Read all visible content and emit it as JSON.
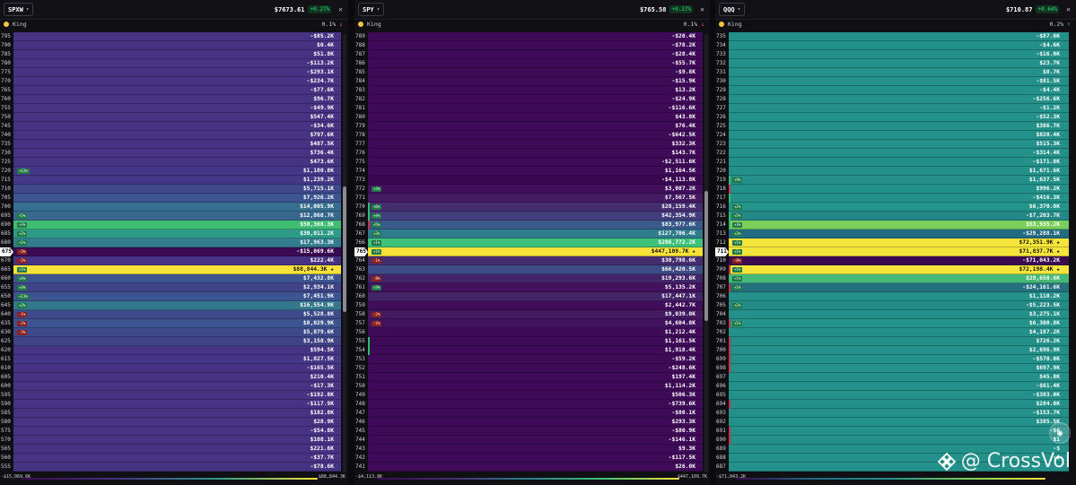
{
  "panels": [
    {
      "ticker": "SPXW",
      "price": "$7673.61",
      "change": "+0.27%",
      "king_label": "King",
      "king_pct": "0.1%",
      "king_dir": "dn",
      "footer_left": "-$15,069.6K",
      "footer_right": "$88,844.3K",
      "pin_strike": "675",
      "rows": [
        {
          "s": "795",
          "v": "-$85.2K",
          "c": "#463383"
        },
        {
          "s": "790",
          "v": "$0.4K",
          "c": "#463383"
        },
        {
          "s": "785",
          "v": "$51.8K",
          "c": "#463383"
        },
        {
          "s": "780",
          "v": "-$113.2K",
          "c": "#463383"
        },
        {
          "s": "775",
          "v": "-$293.1K",
          "c": "#463383"
        },
        {
          "s": "770",
          "v": "-$234.7K",
          "c": "#463383"
        },
        {
          "s": "765",
          "v": "-$77.6K",
          "c": "#463383"
        },
        {
          "s": "760",
          "v": "$96.7K",
          "c": "#463383"
        },
        {
          "s": "755",
          "v": "-$49.9K",
          "c": "#463383"
        },
        {
          "s": "750",
          "v": "$547.4K",
          "c": "#463383"
        },
        {
          "s": "745",
          "v": "-$34.6K",
          "c": "#463383"
        },
        {
          "s": "740",
          "v": "$797.6K",
          "c": "#463383"
        },
        {
          "s": "735",
          "v": "$487.5K",
          "c": "#463383"
        },
        {
          "s": "730",
          "v": "$736.4K",
          "c": "#463383"
        },
        {
          "s": "725",
          "v": "$473.6K",
          "c": "#463383"
        },
        {
          "s": "720",
          "v": "$1,180.8K",
          "c": "#453787",
          "t": "+12%",
          "tc": "tg"
        },
        {
          "s": "715",
          "v": "$1,239.2K",
          "c": "#453787"
        },
        {
          "s": "710",
          "v": "$5,715.1K",
          "c": "#3f4a8b"
        },
        {
          "s": "705",
          "v": "$7,926.2K",
          "c": "#3c5591"
        },
        {
          "s": "700",
          "v": "$14,005.9K",
          "c": "#366e8f"
        },
        {
          "s": "695",
          "v": "$12,868.7K",
          "c": "#38688f",
          "t": "+5%",
          "tc": "tg"
        },
        {
          "s": "690",
          "v": "$50,368.3K",
          "c": "#3fbd72",
          "t": "+3%",
          "tc": "tg"
        },
        {
          "s": "685",
          "v": "$30,011.2K",
          "c": "#2d9b88",
          "t": "+2%",
          "tc": "tg"
        },
        {
          "s": "680",
          "v": "$17,963.3K",
          "c": "#337c8e",
          "t": "+1%",
          "tc": "tg"
        },
        {
          "s": "675",
          "v": "-$15,069.6K",
          "c": "#3a0a52",
          "t": "-3%",
          "tc": "tr"
        },
        {
          "s": "670",
          "v": "$222.4K",
          "c": "#463383",
          "t": "-2%",
          "tc": "tr"
        },
        {
          "s": "665",
          "v": "$88,844.3K",
          "c": "#f7e23a",
          "t": "+1%",
          "tc": "tg",
          "dark": true
        },
        {
          "s": "660",
          "v": "$7,432.8K",
          "c": "#3c5591",
          "t": "+4%",
          "tc": "tg"
        },
        {
          "s": "655",
          "v": "$2,934.1K",
          "c": "#414387",
          "t": "+3%",
          "tc": "tg"
        },
        {
          "s": "650",
          "v": "$7,451.9K",
          "c": "#3c5591",
          "t": "+11%",
          "tc": "tg"
        },
        {
          "s": "645",
          "v": "$16,554.9K",
          "c": "#34788e",
          "t": "+2%",
          "tc": "tg"
        },
        {
          "s": "640",
          "v": "$5,528.8K",
          "c": "#3f4a8b",
          "t": "-1%",
          "tc": "tr"
        },
        {
          "s": "635",
          "v": "$8,029.9K",
          "c": "#3c5591",
          "t": "-2%",
          "tc": "tr"
        },
        {
          "s": "630",
          "v": "$5,879.6K",
          "c": "#3f4a8b",
          "t": "-3%",
          "tc": "tr"
        },
        {
          "s": "625",
          "v": "$3,158.9K",
          "c": "#414387"
        },
        {
          "s": "620",
          "v": "$594.5K",
          "c": "#463383"
        },
        {
          "s": "615",
          "v": "$1,827.5K",
          "c": "#453787"
        },
        {
          "s": "610",
          "v": "-$165.5K",
          "c": "#463383"
        },
        {
          "s": "605",
          "v": "$210.4K",
          "c": "#463383"
        },
        {
          "s": "600",
          "v": "-$17.3K",
          "c": "#463383"
        },
        {
          "s": "595",
          "v": "-$192.8K",
          "c": "#463383"
        },
        {
          "s": "590",
          "v": "-$117.9K",
          "c": "#463383"
        },
        {
          "s": "585",
          "v": "$182.8K",
          "c": "#463383"
        },
        {
          "s": "580",
          "v": "$28.9K",
          "c": "#463383"
        },
        {
          "s": "575",
          "v": "-$54.8K",
          "c": "#463383"
        },
        {
          "s": "570",
          "v": "$108.1K",
          "c": "#463383"
        },
        {
          "s": "565",
          "v": "$221.6K",
          "c": "#463383"
        },
        {
          "s": "560",
          "v": "-$37.7K",
          "c": "#463383"
        },
        {
          "s": "555",
          "v": "-$78.6K",
          "c": "#463383"
        }
      ]
    },
    {
      "ticker": "SPY",
      "price": "$765.58",
      "change": "+0.27%",
      "king_label": "King",
      "king_pct": "0.1%",
      "king_dir": "dn",
      "footer_left": "-$4,113.8K",
      "footer_right": "$447,109.7K",
      "pin_strike": "765",
      "rows": [
        {
          "s": "789",
          "v": "-$20.4K",
          "c": "#3f0a58"
        },
        {
          "s": "788",
          "v": "-$78.2K",
          "c": "#3f0a58"
        },
        {
          "s": "787",
          "v": "-$28.4K",
          "c": "#3f0a58"
        },
        {
          "s": "786",
          "v": "-$55.7K",
          "c": "#3f0a58"
        },
        {
          "s": "785",
          "v": "-$9.8K",
          "c": "#3f0a58"
        },
        {
          "s": "784",
          "v": "-$15.9K",
          "c": "#3f0a58"
        },
        {
          "s": "783",
          "v": "$13.2K",
          "c": "#3f0a58"
        },
        {
          "s": "782",
          "v": "-$24.9K",
          "c": "#3f0a58"
        },
        {
          "s": "781",
          "v": "-$116.6K",
          "c": "#3f0a58"
        },
        {
          "s": "780",
          "v": "$43.8K",
          "c": "#3f0a58"
        },
        {
          "s": "779",
          "v": "$76.4K",
          "c": "#3f0a58"
        },
        {
          "s": "778",
          "v": "-$642.5K",
          "c": "#3f0a58"
        },
        {
          "s": "777",
          "v": "$332.3K",
          "c": "#3f0a58"
        },
        {
          "s": "776",
          "v": "$143.7K",
          "c": "#3f0a58"
        },
        {
          "s": "775",
          "v": "-$2,511.6K",
          "c": "#3f0a58"
        },
        {
          "s": "774",
          "v": "$1,164.5K",
          "c": "#3f0a58"
        },
        {
          "s": "773",
          "v": "-$4,113.8K",
          "c": "#3a0752"
        },
        {
          "s": "772",
          "v": "$3,087.2K",
          "c": "#420f5c",
          "t": "+3%",
          "tc": "tg"
        },
        {
          "s": "771",
          "v": "$7,567.5K",
          "c": "#441a62"
        },
        {
          "s": "770",
          "v": "$28,159.4K",
          "c": "#452e70",
          "t": "+6%",
          "tc": "tg",
          "b": "#2fbf6a"
        },
        {
          "s": "769",
          "v": "$42,354.9K",
          "c": "#433e7e",
          "t": "+4%",
          "tc": "tg",
          "b": "#2fbf6a"
        },
        {
          "s": "768",
          "v": "$83,977.6K",
          "c": "#3a5a8b",
          "t": "+5%",
          "tc": "tg",
          "b": "#c9344a"
        },
        {
          "s": "767",
          "v": "$127,706.4K",
          "c": "#2f7c8d",
          "t": "+3%",
          "tc": "tg"
        },
        {
          "s": "766",
          "v": "$286,772.2K",
          "c": "#3ec27a",
          "t": "+1%",
          "tc": "tg"
        },
        {
          "s": "765",
          "v": "$447,109.7K",
          "c": "#f7e23a",
          "t": "+1%",
          "tc": "tg",
          "dark": true
        },
        {
          "s": "764",
          "v": "$30,798.6K",
          "c": "#452e70",
          "t": "-1%",
          "tc": "tr"
        },
        {
          "s": "763",
          "v": "$66,420.5K",
          "c": "#3d4b86"
        },
        {
          "s": "762",
          "v": "$19,293.6K",
          "c": "#45256a",
          "t": "-8%",
          "tc": "tr"
        },
        {
          "s": "761",
          "v": "$5,135.2K",
          "c": "#42125e",
          "t": "+3%",
          "tc": "tg"
        },
        {
          "s": "760",
          "v": "$17,447.1K",
          "c": "#45256a"
        },
        {
          "s": "759",
          "v": "$2,442.7K",
          "c": "#400d5a"
        },
        {
          "s": "758",
          "v": "$9,039.0K",
          "c": "#431a62",
          "t": "-2%",
          "tc": "tr"
        },
        {
          "s": "757",
          "v": "$4,604.8K",
          "c": "#42125e",
          "t": "-2%",
          "tc": "tr"
        },
        {
          "s": "756",
          "v": "$1,212.4K",
          "c": "#3f0a58"
        },
        {
          "s": "755",
          "v": "$1,161.5K",
          "c": "#3f0a58",
          "b": "#2fbf6a"
        },
        {
          "s": "754",
          "v": "$1,918.4K",
          "c": "#3f0a58",
          "b": "#2fbf6a"
        },
        {
          "s": "753",
          "v": "-$59.2K",
          "c": "#3f0a58"
        },
        {
          "s": "752",
          "v": "-$248.6K",
          "c": "#3f0a58"
        },
        {
          "s": "751",
          "v": "$197.4K",
          "c": "#3f0a58"
        },
        {
          "s": "750",
          "v": "$1,114.2K",
          "c": "#3f0a58"
        },
        {
          "s": "749",
          "v": "$506.3K",
          "c": "#3f0a58"
        },
        {
          "s": "748",
          "v": "-$739.6K",
          "c": "#3f0a58"
        },
        {
          "s": "747",
          "v": "-$80.1K",
          "c": "#3f0a58"
        },
        {
          "s": "746",
          "v": "$293.3K",
          "c": "#3f0a58"
        },
        {
          "s": "745",
          "v": "-$80.9K",
          "c": "#3f0a58"
        },
        {
          "s": "744",
          "v": "-$146.1K",
          "c": "#3f0a58"
        },
        {
          "s": "743",
          "v": "$9.3K",
          "c": "#3f0a58"
        },
        {
          "s": "742",
          "v": "-$117.5K",
          "c": "#3f0a58"
        },
        {
          "s": "741",
          "v": "$26.0K",
          "c": "#3f0a58"
        }
      ]
    },
    {
      "ticker": "QQQ",
      "price": "$710.87",
      "change": "+0.64%",
      "king_label": "King",
      "king_pct": "0.2%",
      "king_dir": "up",
      "footer_left": "-$71,043.2K",
      "footer_right": "",
      "pin_strike": "711",
      "rows": [
        {
          "s": "735",
          "v": "-$87.6K",
          "c": "#23918a"
        },
        {
          "s": "734",
          "v": "-$4.6K",
          "c": "#23918a"
        },
        {
          "s": "733",
          "v": "-$16.0K",
          "c": "#23918a"
        },
        {
          "s": "732",
          "v": "$23.7K",
          "c": "#23918a"
        },
        {
          "s": "731",
          "v": "$0.7K",
          "c": "#23918a"
        },
        {
          "s": "730",
          "v": "-$81.5K",
          "c": "#23918a"
        },
        {
          "s": "729",
          "v": "-$4.4K",
          "c": "#23918a"
        },
        {
          "s": "728",
          "v": "-$256.6K",
          "c": "#23918a"
        },
        {
          "s": "727",
          "v": "-$1.2K",
          "c": "#23918a"
        },
        {
          "s": "726",
          "v": "-$52.3K",
          "c": "#23918a"
        },
        {
          "s": "725",
          "v": "$386.7K",
          "c": "#23918a"
        },
        {
          "s": "724",
          "v": "$820.4K",
          "c": "#23918a"
        },
        {
          "s": "723",
          "v": "$515.3K",
          "c": "#23918a"
        },
        {
          "s": "722",
          "v": "-$314.4K",
          "c": "#23918a"
        },
        {
          "s": "721",
          "v": "-$171.8K",
          "c": "#23918a"
        },
        {
          "s": "720",
          "v": "$1,671.6K",
          "c": "#23918a"
        },
        {
          "s": "719",
          "v": "$1,637.5K",
          "c": "#23918a",
          "t": "+9%",
          "tc": "tg",
          "b": "#2fbf6a"
        },
        {
          "s": "718",
          "v": "$996.2K",
          "c": "#23918a",
          "b": "#c9344a"
        },
        {
          "s": "717",
          "v": "-$416.3K",
          "c": "#23918a",
          "b": "#2fbf6a"
        },
        {
          "s": "716",
          "v": "$6,370.0K",
          "c": "#24958a",
          "t": "+2%",
          "tc": "tg"
        },
        {
          "s": "715",
          "v": "-$7,203.7K",
          "c": "#238886",
          "t": "+5%",
          "tc": "tg",
          "b": "#2fbf6a"
        },
        {
          "s": "714",
          "v": "$53,935.2K",
          "c": "#7ad05a",
          "t": "+3%",
          "tc": "tg",
          "b": "#2fbf6a"
        },
        {
          "s": "713",
          "v": "-$29,288.1K",
          "c": "#236b82",
          "t": "+2%",
          "tc": "tg"
        },
        {
          "s": "712",
          "v": "$72,351.9K",
          "c": "#f5e43a",
          "t": "+1%",
          "tc": "tg",
          "dark": true
        },
        {
          "s": "711",
          "v": "$71,837.7K",
          "c": "#f5e43a",
          "t": "+1%",
          "tc": "tg",
          "dark": true
        },
        {
          "s": "710",
          "v": "-$71,043.2K",
          "c": "#3a0a52",
          "t": "-8%",
          "tc": "tr"
        },
        {
          "s": "709",
          "v": "$72,198.4K",
          "c": "#f5e43a",
          "t": "+1%",
          "tc": "tg",
          "dark": true,
          "b": "#c9344a"
        },
        {
          "s": "708",
          "v": "$29,650.6K",
          "c": "#46b978",
          "t": "+1%",
          "tc": "tg"
        },
        {
          "s": "707",
          "v": "-$24,161.6K",
          "c": "#23717f",
          "t": "+1%",
          "tc": "tg",
          "b": "#c9344a"
        },
        {
          "s": "706",
          "v": "$1,110.2K",
          "c": "#23918a"
        },
        {
          "s": "705",
          "v": "-$5,223.5K",
          "c": "#238a86",
          "t": "+2%",
          "tc": "tg"
        },
        {
          "s": "704",
          "v": "$3,275.1K",
          "c": "#23918a"
        },
        {
          "s": "703",
          "v": "$6,300.8K",
          "c": "#24958a",
          "t": "+1%",
          "tc": "tg",
          "b": "#c9344a"
        },
        {
          "s": "702",
          "v": "$4,187.2K",
          "c": "#23918a"
        },
        {
          "s": "701",
          "v": "$726.2K",
          "c": "#23918a",
          "b": "#c9344a"
        },
        {
          "s": "700",
          "v": "$2,696.9K",
          "c": "#23918a",
          "b": "#c9344a"
        },
        {
          "s": "699",
          "v": "-$570.0K",
          "c": "#23918a",
          "b": "#c9344a"
        },
        {
          "s": "698",
          "v": "$697.9K",
          "c": "#23918a",
          "b": "#c9344a"
        },
        {
          "s": "697",
          "v": "$45.8K",
          "c": "#23918a"
        },
        {
          "s": "696",
          "v": "-$61.4K",
          "c": "#23918a"
        },
        {
          "s": "695",
          "v": "-$383.0K",
          "c": "#23918a"
        },
        {
          "s": "694",
          "v": "$284.0K",
          "c": "#23918a",
          "b": "#c9344a"
        },
        {
          "s": "693",
          "v": "-$153.7K",
          "c": "#23918a"
        },
        {
          "s": "692",
          "v": "$385.5K",
          "c": "#23918a"
        },
        {
          "s": "691",
          "v": "-$6",
          "c": "#23918a",
          "b": "#c9344a"
        },
        {
          "s": "690",
          "v": "$1",
          "c": "#23918a",
          "b": "#c9344a"
        },
        {
          "s": "689",
          "v": "-$",
          "c": "#23918a"
        },
        {
          "s": "688",
          "v": "-$",
          "c": "#23918a"
        },
        {
          "s": "687",
          "v": "",
          "c": "#23918a"
        }
      ]
    }
  ],
  "watermark": "@ CrossVol",
  "colors": {
    "positive": "#26e07a",
    "negative": "#ff5a5a",
    "king": "#f7e23a"
  },
  "icons": [
    "chevron-down-icon",
    "close-icon",
    "king-dot-icon",
    "camera-icon",
    "binance-logo-icon"
  ]
}
